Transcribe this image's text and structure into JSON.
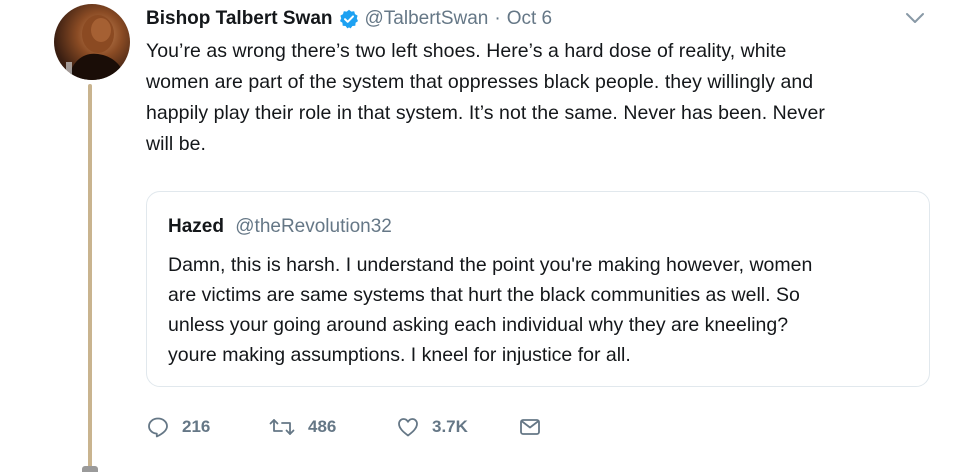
{
  "tweet": {
    "author_name": "Bishop Talbert Swan",
    "author_handle": "@TalbertSwan",
    "separator": "·",
    "date": "Oct 6",
    "text_lines": [
      "You’re as wrong there’s two left shoes. Here’s a hard dose of reality, white",
      "women are part of the system that oppresses black people. they willingly and",
      "happily play their role in that system. It’s not the same. Never has been. Never",
      "will be."
    ]
  },
  "quoted_tweet": {
    "author_name": "Hazed",
    "author_handle": "@theRevolution32",
    "text_lines": [
      "Damn, this is harsh. I understand the point you're making however, women",
      "are victims are same systems that hurt the black communities as well. So",
      "unless your going around asking each individual why they are kneeling?",
      "youre making assumptions. I kneel for injustice for all."
    ]
  },
  "actions": {
    "reply_count": "216",
    "retweet_count": "486",
    "like_count": "3.7K"
  },
  "icons": {
    "verified": "verified-badge-icon",
    "menu": "chevron-down-icon",
    "reply": "reply-icon",
    "retweet": "retweet-icon",
    "like": "heart-icon",
    "dm": "envelope-icon"
  },
  "colors": {
    "text": "#14171a",
    "secondary": "#657786",
    "verified": "#1da1f2",
    "border": "#e1e8ed",
    "thread_line": "#c9b48f"
  }
}
